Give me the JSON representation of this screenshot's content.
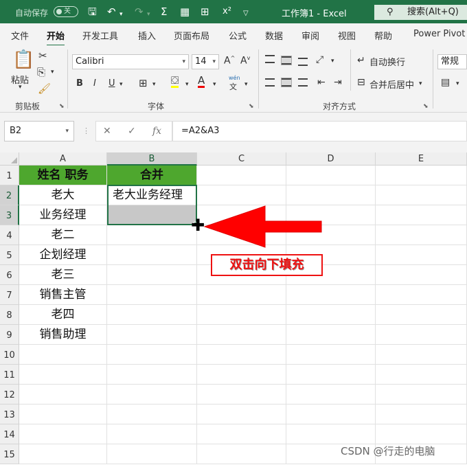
{
  "title_bar": {
    "autosave_label": "自动保存",
    "autosave_state": "关",
    "document_title": "工作簿1 - Excel",
    "search_placeholder": "搜索(Alt+Q)"
  },
  "tabs": [
    "文件",
    "开始",
    "开发工具",
    "插入",
    "页面布局",
    "公式",
    "数据",
    "审阅",
    "视图",
    "帮助",
    "Power Pivot"
  ],
  "active_tab": "开始",
  "ribbon": {
    "clipboard": {
      "paste_label": "粘贴",
      "group_label": "剪贴板"
    },
    "font": {
      "font_name": "Calibri",
      "font_size": "14",
      "phonetic_label": "wén",
      "group_label": "字体"
    },
    "alignment": {
      "wrap_text_label": "自动换行",
      "merge_center_label": "合并后居中",
      "group_label": "对齐方式"
    },
    "number": {
      "format": "常规"
    }
  },
  "formula_bar": {
    "name_box": "B2",
    "formula": "=A2&A3"
  },
  "sheet": {
    "columns": [
      "A",
      "B",
      "C",
      "D",
      "E"
    ],
    "rows": [
      "1",
      "2",
      "3",
      "4",
      "5",
      "6",
      "7",
      "8",
      "9",
      "10",
      "11",
      "12",
      "13",
      "14",
      "15"
    ],
    "cells": {
      "A1": "姓名  职务",
      "B1": "合并",
      "A2": "老大",
      "B2": "老大业务经理",
      "A3": "业务经理",
      "A4": "老二",
      "A5": "企划经理",
      "A6": "老三",
      "A7": "销售主管",
      "A8": "老四",
      "A9": "销售助理"
    }
  },
  "annotation": "双击向下填充",
  "watermark": "CSDN @行走的电脑",
  "colors": {
    "brand": "#217346",
    "header_fill": "#4ea72e",
    "arrow": "#ff0000"
  }
}
